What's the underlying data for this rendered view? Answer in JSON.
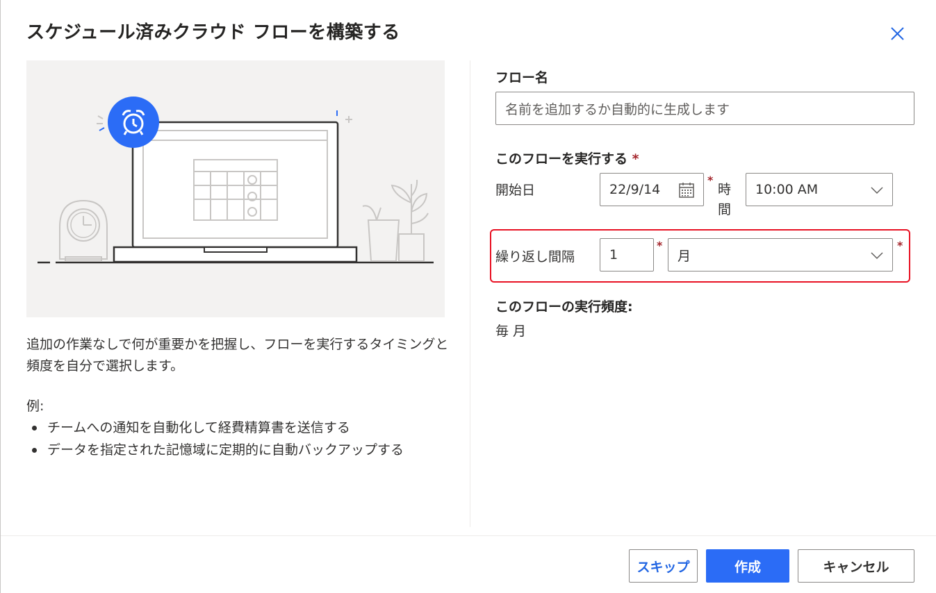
{
  "dialog": {
    "title": "スケジュール済みクラウド フローを構築する",
    "close_icon": "close-icon"
  },
  "left": {
    "description": "追加の作業なしで何が重要かを把握し、フローを実行するタイミングと頻度を自分で選択します。",
    "example_label": "例:",
    "examples": [
      "チームへの通知を自動化して経費精算書を送信する",
      "データを指定された記憶域に定期的に自動バックアップする"
    ]
  },
  "form": {
    "flow_name_label": "フロー名",
    "flow_name_placeholder": "名前を追加するか自動的に生成します",
    "run_label": "このフローを実行する",
    "required_mark": "*",
    "start_date_label": "開始日",
    "start_date_value": "22/9/14",
    "time_label_1": "時",
    "time_label_2": "間",
    "time_value": "10:00 AM",
    "repeat_label": "繰り返し間隔",
    "repeat_interval": "1",
    "repeat_unit": "月",
    "frequency_label": "このフローの実行頻度:",
    "frequency_value": "毎 月"
  },
  "footer": {
    "skip": "スキップ",
    "create": "作成",
    "cancel": "キャンセル"
  },
  "colors": {
    "accent": "#2b6cf6",
    "required": "#a4262c",
    "highlight": "#e81123"
  }
}
